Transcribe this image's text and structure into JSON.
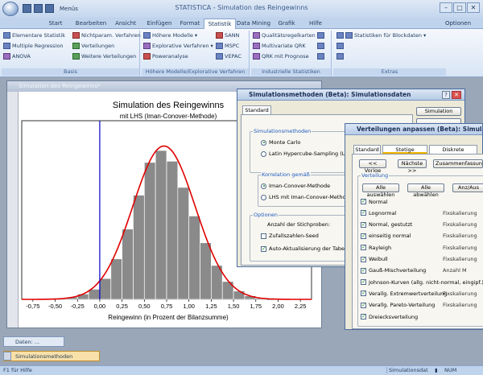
{
  "app": {
    "title": "STATISTICA - Simulation des Reingewinns",
    "menus_label": "Menüs",
    "options_label": "Optionen"
  },
  "tabs": [
    "Start",
    "Bearbeiten",
    "Ansicht",
    "Einfügen",
    "Format",
    "Statistik",
    "Data Mining",
    "Grafik",
    "Hilfe"
  ],
  "active_tab": "Statistik",
  "ribbon": {
    "basis": {
      "label": "Basis",
      "items": [
        "Elementare Statistik",
        "Nichtparam. Verfahren",
        "Multiple Regression",
        "Verteilungen",
        "ANOVA",
        "Weitere Verteilungen"
      ]
    },
    "hoehere": {
      "label": "Höhere Modelle/Explorative Verfahren",
      "items": [
        "Höhere Modelle",
        "SANN",
        "Explorative Verfahren",
        "MSPC",
        "Poweranalyse",
        "VEPAC"
      ]
    },
    "industrie": {
      "label": "Industrielle Statistiken",
      "items": [
        "Qualitätsregelkarten",
        "Multivariate QRK",
        "QRK mit Prognose"
      ]
    },
    "extras": {
      "label": "Extras",
      "items": [
        "Statistiken für Blockdaten"
      ]
    }
  },
  "graph_window": {
    "title": "Simulation des Reingewinns*",
    "chart_title": "Simulation des Reingewinns",
    "chart_subtitle": "mit LHS (Iman-Conover-Methode)",
    "xlabel": "Reingewinn (in Prozent der Bilanzsumme)"
  },
  "chart_data": {
    "type": "bar",
    "title": "Simulation des Reingewinns",
    "subtitle": "mit LHS (Iman-Conover-Methode)",
    "xlabel": "Reingewinn (in Prozent der Bilanzsumme)",
    "ylabel": "",
    "x_ticks": [
      "-0,75",
      "-0,50",
      "-0,25",
      "0,00",
      "0,25",
      "0,50",
      "0,75",
      "1,00",
      "1,25",
      "1,50",
      "1,75",
      "2,00",
      "2,25"
    ],
    "xlim": [
      -0.875,
      2.375
    ],
    "bin_width": 0.125,
    "bin_starts": [
      -0.5,
      -0.375,
      -0.25,
      -0.125,
      0.0,
      0.125,
      0.25,
      0.375,
      0.5,
      0.625,
      0.75,
      0.875,
      1.0,
      1.125,
      1.25,
      1.375,
      1.5,
      1.625,
      1.75
    ],
    "values": [
      2,
      4,
      9,
      17,
      35,
      68,
      118,
      175,
      230,
      250,
      232,
      188,
      140,
      95,
      57,
      30,
      14,
      6,
      2
    ],
    "ylim": [
      0,
      300
    ],
    "fit_curve": {
      "type": "normal",
      "mean": 0.72,
      "sd": 0.35,
      "color": "#e00000"
    },
    "reference_line": {
      "x": 0.0,
      "color": "#0000cc"
    },
    "bar_color": "#8a8a8a",
    "grid": false
  },
  "dialog_sim": {
    "title": "Simulationsmethoden (Beta): Simulationsdaten",
    "tab": "Standard",
    "simulate_button": "Simulation",
    "group_methods": "Simulationsmethoden",
    "method_options": [
      "Monte Carlo",
      "Latin Hypercube-Sampling (LHS)"
    ],
    "method_selected": 0,
    "group_correlation": "Korrelation gemäß",
    "corr_options": [
      "Iman-Conover-Methode",
      "LHS mit Iman-Conover-Methode"
    ],
    "corr_selected": 0,
    "group_options": "Optionen",
    "samples_label": "Anzahl der Stichproben:",
    "random_seed_label": "Zufallszahlen-Seed",
    "auto_update_label": "Auto-Aktualisierung der Tabelle"
  },
  "dialog_fit": {
    "title": "Verteilungen anpassen (Beta): Simulation",
    "tabs": [
      "Standard",
      "Stetige Variablen",
      "Diskrete Variablen"
    ],
    "active_tab": 1,
    "prev_button": "<< Vorige",
    "next_button": "Nächste >>",
    "summary_button": "Zusammenfassung",
    "group_label": "Verteilung",
    "select_all": "Alle auswählen",
    "deselect_all": "Alle abwählen",
    "auto_label": "Anz/Aus",
    "distributions": [
      {
        "name": "Normal",
        "checked": true,
        "info": ""
      },
      {
        "name": "Lognormal",
        "checked": true,
        "info": "Fixskalierung"
      },
      {
        "name": "Normal, gestutzt",
        "checked": true,
        "info": "Fixskalierung"
      },
      {
        "name": "einseitig normal",
        "checked": true,
        "info": "Fixskalierung"
      },
      {
        "name": "Rayleigh",
        "checked": true,
        "info": "Fixskalierung"
      },
      {
        "name": "Weibull",
        "checked": true,
        "info": "Fixskalierung"
      },
      {
        "name": "Gauß-Mischverteilung",
        "checked": true,
        "info": "Anzahl M"
      },
      {
        "name": "Johnson-Kurven (allg. nicht-normal, eingipf.)",
        "checked": true,
        "info": ""
      },
      {
        "name": "Verallg. Extremwertverteilung",
        "checked": true,
        "info": "Fixskalierung"
      },
      {
        "name": "Verallg. Pareto-Verteilung",
        "checked": true,
        "info": "Fixskalierung"
      },
      {
        "name": "Dreiecksverteilung",
        "checked": true,
        "info": ""
      }
    ]
  },
  "minimized": [
    {
      "title": "Daten: ..."
    },
    {
      "title": "Simulationsmethoden"
    }
  ],
  "statusbar": {
    "help": "F1 für Hilfe",
    "panel1": "Simulationsdat",
    "panel2": "NUM"
  }
}
